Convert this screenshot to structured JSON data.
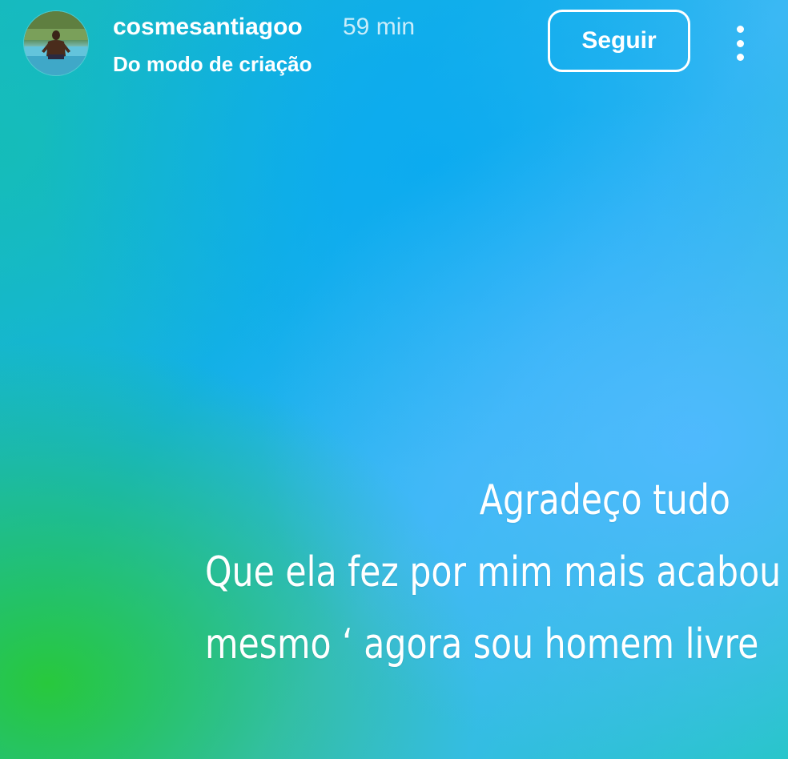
{
  "header": {
    "username": "cosmesantiagoo",
    "timestamp": "59 min",
    "subtitle": "Do modo de criação",
    "follow_label": "Seguir",
    "avatar_icon": "profile-photo",
    "more_icon": "more-vertical-icon"
  },
  "story": {
    "lines": [
      "Agradeço tudo",
      "Que ela fez por mim mais acabou",
      "mesmo ‘ agora sou homem livre"
    ]
  },
  "colors": {
    "text": "#ffffff",
    "gradient_green": "#28c83c",
    "gradient_blue": "#14b0e8",
    "gradient_light_blue": "#50b9ff"
  }
}
